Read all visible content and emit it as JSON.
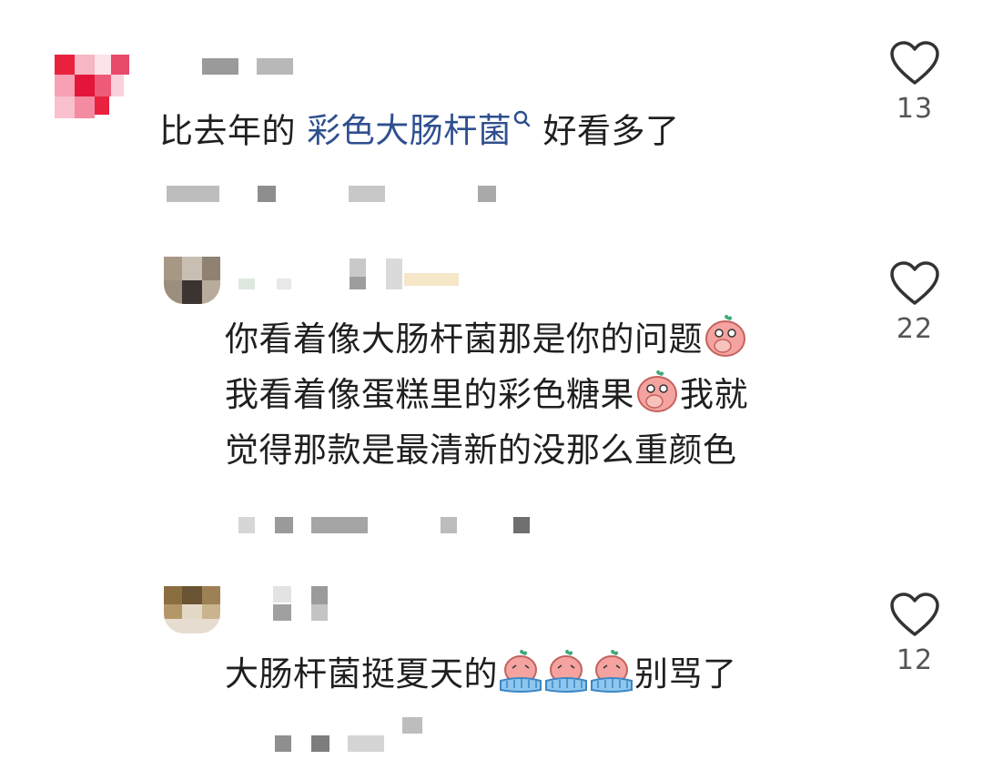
{
  "comments": [
    {
      "text_plain": "比去年的 ",
      "text_link": "彩色大肠杆菌",
      "link_icon": "search-icon",
      "text_tail": " 好看多了",
      "likes": "13"
    },
    {
      "lines": [
        "你看着像大肠杆菌那是你的问题",
        "我看着像蛋糕里的彩色糖果",
        "我就",
        "觉得那款是最清新的没那么重颜色"
      ],
      "emojis": [
        "peach-hand-over-mouth-emoji",
        "peach-hand-over-mouth-emoji"
      ],
      "likes": "22"
    },
    {
      "text": "大肠杆菌挺夏天的",
      "emojis": [
        "peach-crying-emoji",
        "peach-crying-emoji",
        "peach-crying-emoji"
      ],
      "text_tail": "别骂了",
      "likes": "12"
    }
  ],
  "icons": {
    "like": "heart-outline-icon"
  },
  "colors": {
    "link": "#2f4f8f",
    "text": "#1f1f1f",
    "count": "#555555"
  }
}
